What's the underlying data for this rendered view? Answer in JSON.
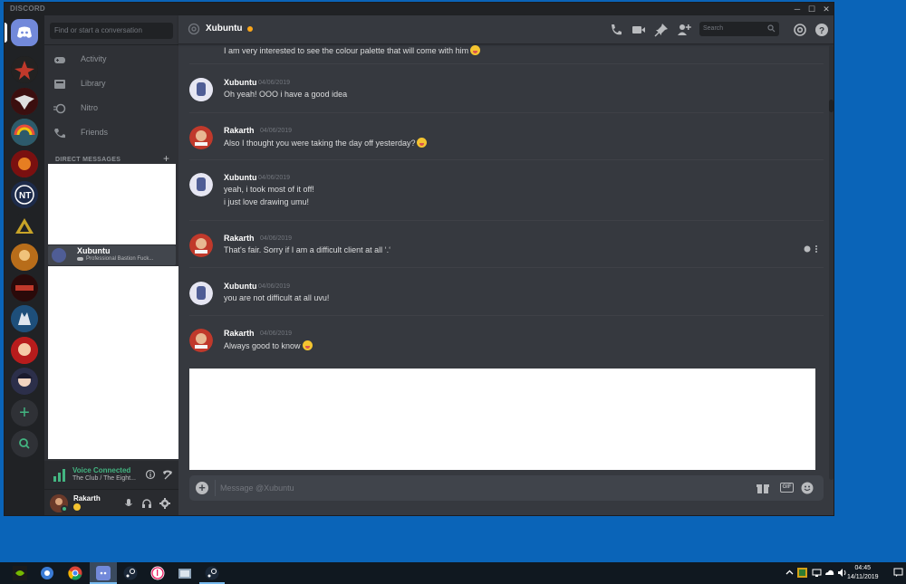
{
  "app": {
    "brand": "DISCORD"
  },
  "window_controls": {
    "minimize": "─",
    "maximize": "☐",
    "close": "✕"
  },
  "dm_column": {
    "search_placeholder": "Find or start a conversation",
    "nav": [
      {
        "label": "Activity",
        "icon": "gamepad-icon"
      },
      {
        "label": "Library",
        "icon": "library-icon"
      },
      {
        "label": "Nitro",
        "icon": "nitro-icon"
      },
      {
        "label": "Friends",
        "icon": "friends-icon"
      }
    ],
    "direct_messages_header": "DIRECT MESSAGES",
    "add_dm": "+",
    "selected_dm": {
      "name": "Xubuntu",
      "status": "Professional Bastion Fuck..."
    }
  },
  "voice": {
    "status": "Voice Connected",
    "channel": "The Club / The Eight..."
  },
  "user_panel": {
    "name": "Rakarth"
  },
  "chat": {
    "recipient": "Xubuntu",
    "search_placeholder": "Search",
    "messages": [
      {
        "author": "",
        "timestamp": "",
        "lines": [
          "I am very interested to see the colour palette that will come with him"
        ],
        "emoji": true
      },
      {
        "author": "Xubuntu",
        "timestamp": "04/06/2019",
        "lines": [
          "Oh yeah! OOO i have a good idea"
        ],
        "emoji": false
      },
      {
        "author": "Rakarth",
        "timestamp": "04/06/2019",
        "lines": [
          "Also I thought you were taking the day off yesterday?"
        ],
        "emoji": true
      },
      {
        "author": "Xubuntu",
        "timestamp": "04/06/2019",
        "lines": [
          "yeah, i took most of it off!",
          "i just love drawing umu!"
        ],
        "emoji": false
      },
      {
        "author": "Rakarth",
        "timestamp": "04/06/2019",
        "lines": [
          "That's fair. Sorry if I am a difficult client at all ‘.‘"
        ],
        "emoji": false
      },
      {
        "author": "Xubuntu",
        "timestamp": "04/06/2019",
        "lines": [
          "you are not difficult at all uvu!"
        ],
        "emoji": false
      },
      {
        "author": "Rakarth",
        "timestamp": "04/06/2019",
        "lines": [
          "Always good to know"
        ],
        "emoji": true
      }
    ],
    "composer_placeholder": "Message @Xubuntu",
    "gif_label": "GIF"
  },
  "taskbar": {
    "time": "04:45",
    "date": "14/11/2019"
  },
  "colors": {
    "blurple": "#7289da",
    "green": "#43b581",
    "bg": "#36393f"
  }
}
